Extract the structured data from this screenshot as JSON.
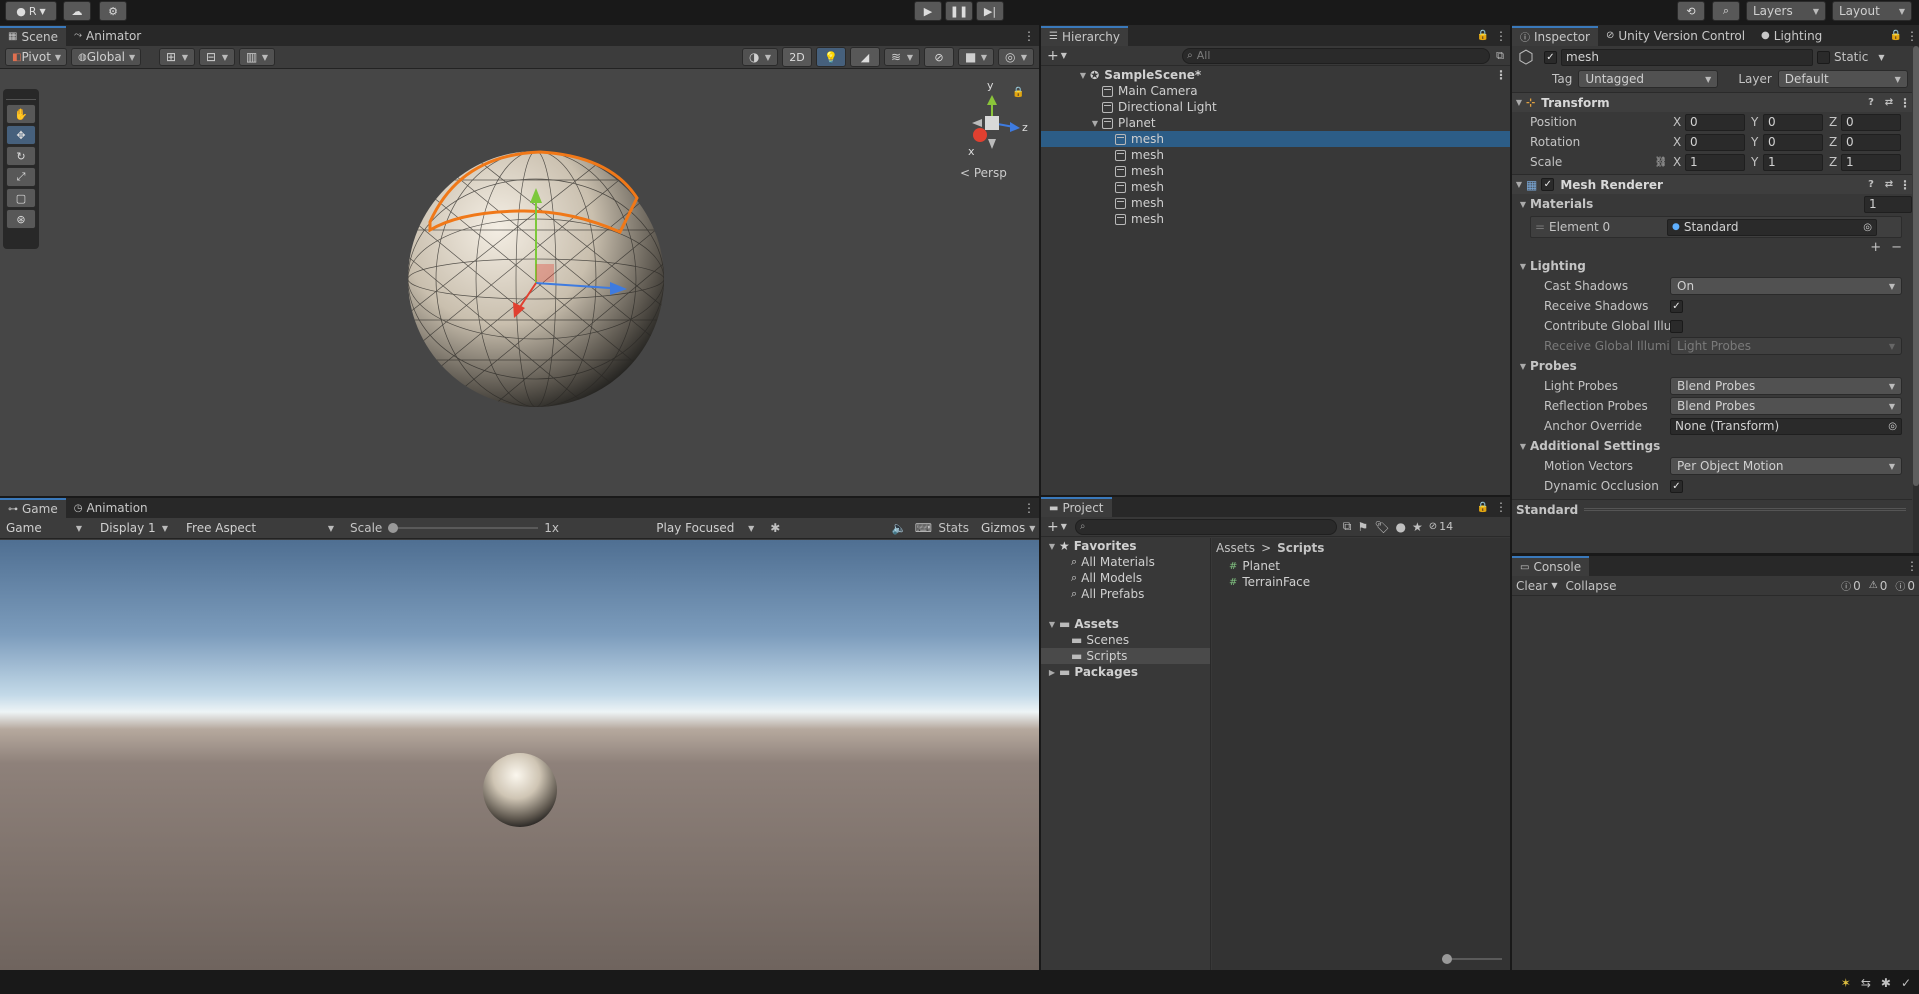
{
  "topbar": {
    "account": "R"
  },
  "scene": {
    "tabs": [
      {
        "label": "Scene"
      },
      {
        "label": "Animator"
      }
    ],
    "toolbar": {
      "pivot": "Pivot",
      "global": "Global",
      "mode2d": "2D"
    },
    "persp": "< Persp",
    "gizmo": {
      "y": "y",
      "z": "z",
      "x": "x"
    }
  },
  "game": {
    "tabs": [
      {
        "label": "Game"
      },
      {
        "label": "Animation"
      }
    ],
    "toolbar": {
      "display_mode": "Game",
      "display": "Display 1",
      "aspect": "Free Aspect",
      "scale_label": "Scale",
      "scale_value": "1x",
      "play_mode": "Play Focused",
      "stats": "Stats",
      "gizmos": "Gizmos"
    }
  },
  "hierarchy": {
    "tab": "Hierarchy",
    "search_placeholder": "All",
    "items": [
      {
        "label": "SampleScene*"
      },
      {
        "label": "Main Camera"
      },
      {
        "label": "Directional Light"
      },
      {
        "label": "Planet"
      },
      {
        "label": "mesh"
      },
      {
        "label": "mesh"
      },
      {
        "label": "mesh"
      },
      {
        "label": "mesh"
      },
      {
        "label": "mesh"
      },
      {
        "label": "mesh"
      }
    ]
  },
  "project": {
    "tab": "Project",
    "badge": "14",
    "favorites": "Favorites",
    "fav_items": [
      {
        "label": "All Materials"
      },
      {
        "label": "All Models"
      },
      {
        "label": "All Prefabs"
      }
    ],
    "assets": "Assets",
    "asset_items": [
      {
        "label": "Scenes"
      },
      {
        "label": "Scripts"
      }
    ],
    "packages": "Packages",
    "breadcrumb": {
      "root": "Assets",
      "sep": ">",
      "current": "Scripts"
    },
    "files": [
      {
        "label": "Planet"
      },
      {
        "label": "TerrainFace"
      }
    ]
  },
  "inspector": {
    "tabs": [
      {
        "label": "Inspector"
      },
      {
        "label": "Unity Version Control"
      },
      {
        "label": "Lighting"
      }
    ],
    "object_name": "mesh",
    "static_label": "Static",
    "tag_label": "Tag",
    "tag_value": "Untagged",
    "layer_label": "Layer",
    "layer_value": "Default",
    "transform": {
      "title": "Transform",
      "position": {
        "label": "Position",
        "x": "0",
        "y": "0",
        "z": "0"
      },
      "rotation": {
        "label": "Rotation",
        "x": "0",
        "y": "0",
        "z": "0"
      },
      "scale": {
        "label": "Scale",
        "x": "1",
        "y": "1",
        "z": "1"
      },
      "axis": {
        "x": "X",
        "y": "Y",
        "z": "Z"
      }
    },
    "mesh_renderer": {
      "title": "Mesh Renderer",
      "materials_label": "Materials",
      "materials_count": "1",
      "element0_label": "Element 0",
      "element0_value": "Standard",
      "lighting_label": "Lighting",
      "cast_shadows_label": "Cast Shadows",
      "cast_shadows_value": "On",
      "receive_shadows_label": "Receive Shadows",
      "contribute_gi_label": "Contribute Global Illun",
      "receive_gi_label": "Receive Global Illumi",
      "receive_gi_value": "Light Probes",
      "probes_label": "Probes",
      "light_probes_label": "Light Probes",
      "light_probes_value": "Blend Probes",
      "reflection_probes_label": "Reflection Probes",
      "reflection_probes_value": "Blend Probes",
      "anchor_label": "Anchor Override",
      "anchor_value": "None (Transform)",
      "additional_label": "Additional Settings",
      "motion_label": "Motion Vectors",
      "motion_value": "Per Object Motion",
      "dynamic_label": "Dynamic Occlusion"
    },
    "material_footer": "Standard"
  },
  "console": {
    "tab": "Console",
    "clear": "Clear",
    "collapse": "Collapse",
    "counts": {
      "info": "0",
      "warn": "0",
      "error": "0"
    }
  },
  "topbar_right": {
    "layers": "Layers",
    "layout": "Layout"
  }
}
